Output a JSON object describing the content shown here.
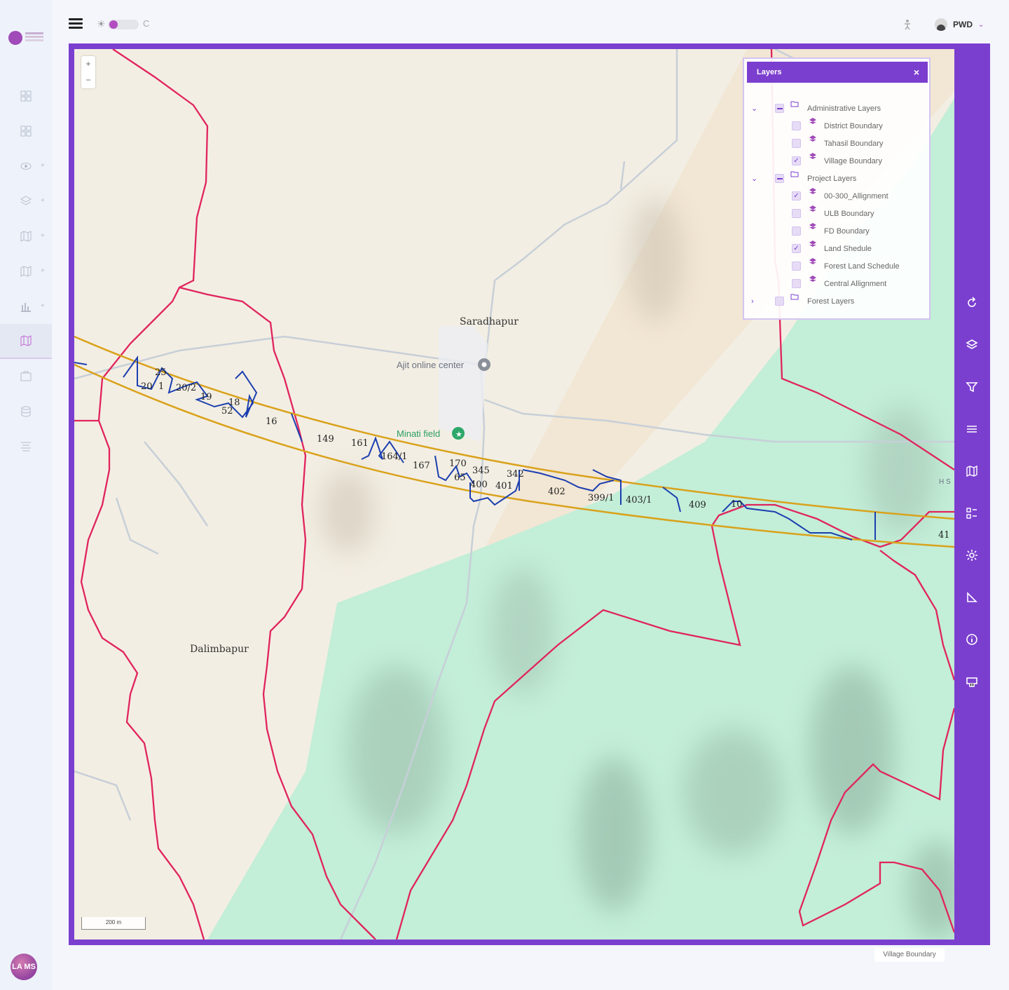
{
  "topbar": {
    "user_name": "PWD",
    "theme_light": "☀",
    "theme_dark": "C"
  },
  "avatar_text": "LA MS",
  "map": {
    "places": {
      "saradhapur": "Saradhapur",
      "dalimbapur": "Dalimbapur",
      "ajit_center": "Ajit online center",
      "minati_field": "Minati field",
      "edge_label": "H S"
    },
    "parcels": [
      "25",
      "20",
      "1",
      "20/2",
      "19",
      "52",
      "18",
      "16",
      "149",
      "161",
      "164/1",
      "167",
      "170",
      "345",
      "65",
      "400",
      "401",
      "342",
      "402",
      "399/1",
      "403/1",
      "409",
      "10",
      "41"
    ],
    "scale_label": "200 m",
    "zoom_in": "+",
    "zoom_out": "−"
  },
  "layers_panel": {
    "title": "Layers",
    "close": "×",
    "groups": [
      {
        "label": "Administrative Layers",
        "expanded": true,
        "items": [
          {
            "label": "District Boundary",
            "checked": false
          },
          {
            "label": "Tahasil Boundary",
            "checked": false
          },
          {
            "label": "Village Boundary",
            "checked": true
          }
        ]
      },
      {
        "label": "Project Layers",
        "expanded": true,
        "items": [
          {
            "label": "00-300_Allignment",
            "checked": true
          },
          {
            "label": "ULB Boundary",
            "checked": false
          },
          {
            "label": "FD Boundary",
            "checked": false
          },
          {
            "label": "Land Shedule",
            "checked": true
          },
          {
            "label": "Forest Land Schedule",
            "checked": false
          },
          {
            "label": "Central Allignment",
            "checked": false
          }
        ]
      },
      {
        "label": "Forest Layers",
        "expanded": false,
        "items": []
      }
    ]
  },
  "legend_chip": "Village Boundary",
  "colors": {
    "brand": "#7b3fcf",
    "village_boundary": "#e0245e",
    "alignment": "#d9a21b",
    "parcel": "#1c3fb0",
    "forest": "#c3eed8",
    "land": "#f3eee3"
  },
  "icons": {
    "rail": [
      "refresh-icon",
      "layers-icon",
      "filter-icon",
      "table-icon",
      "map-icon",
      "list-icon",
      "settings-icon",
      "measure-icon",
      "info-icon",
      "print-icon"
    ]
  }
}
